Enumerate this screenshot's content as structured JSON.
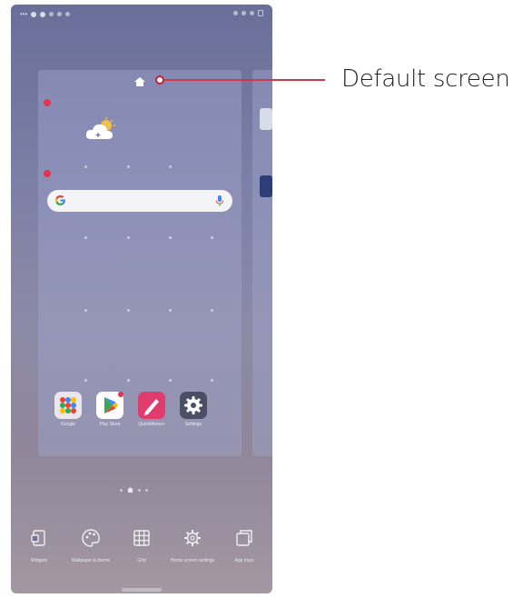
{
  "callout": {
    "label": "Default screen",
    "color": "#cc3a4e"
  },
  "status_bar": {
    "left_icons": [
      "notification-dot-icon",
      "notification-dot-icon",
      "notification-dot-icon"
    ],
    "right_icons": [
      "wifi-icon",
      "signal-icon",
      "battery-icon"
    ]
  },
  "home_page": {
    "default_home_icon": "home-icon",
    "weather_widget_icon": "partly-cloudy-icon",
    "search_bar": {
      "logo": "google-g-icon",
      "mic": "mic-icon"
    }
  },
  "apps": [
    {
      "label": "Google",
      "icon": "google-folder-icon"
    },
    {
      "label": "Play Store",
      "icon": "play-store-icon"
    },
    {
      "label": "QuickMemo+",
      "icon": "quickmemo-icon"
    },
    {
      "label": "Settings",
      "icon": "gear-icon"
    }
  ],
  "bottom_menu": [
    {
      "label": "Widgets",
      "icon": "widgets-icon"
    },
    {
      "label": "Wallpaper & theme",
      "icon": "palette-icon"
    },
    {
      "label": "Grid",
      "icon": "grid-icon"
    },
    {
      "label": "Home screen settings",
      "icon": "gear-icon"
    },
    {
      "label": "App trays",
      "icon": "app-tray-icon"
    }
  ],
  "colors": {
    "accent": "#e6334f",
    "wallpaper_top": "#6a6f99",
    "wallpaper_bottom": "#a397a2"
  }
}
